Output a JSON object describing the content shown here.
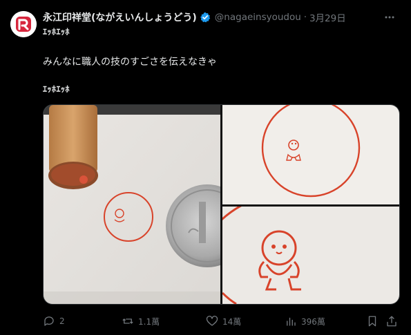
{
  "post": {
    "author_name": "永江印祥堂(ながえいんしょうどう)",
    "handle": "@nagaeinsyoudou",
    "separator": "·",
    "date": "3月29日",
    "subline": "ｴｯﾎｴｯﾎ",
    "text": "みんなに職人の技のすごさを伝えなきゃ",
    "text2": "ｴｯﾎｴｯﾎ"
  },
  "actions": {
    "replies": "2",
    "reposts": "1.1萬",
    "likes": "14萬",
    "views": "396萬"
  },
  "colors": {
    "background": "#000000",
    "text": "#e7e9ea",
    "muted": "#71767b",
    "verified": "#1d9bf0",
    "stamp_red": "#d8432a"
  }
}
